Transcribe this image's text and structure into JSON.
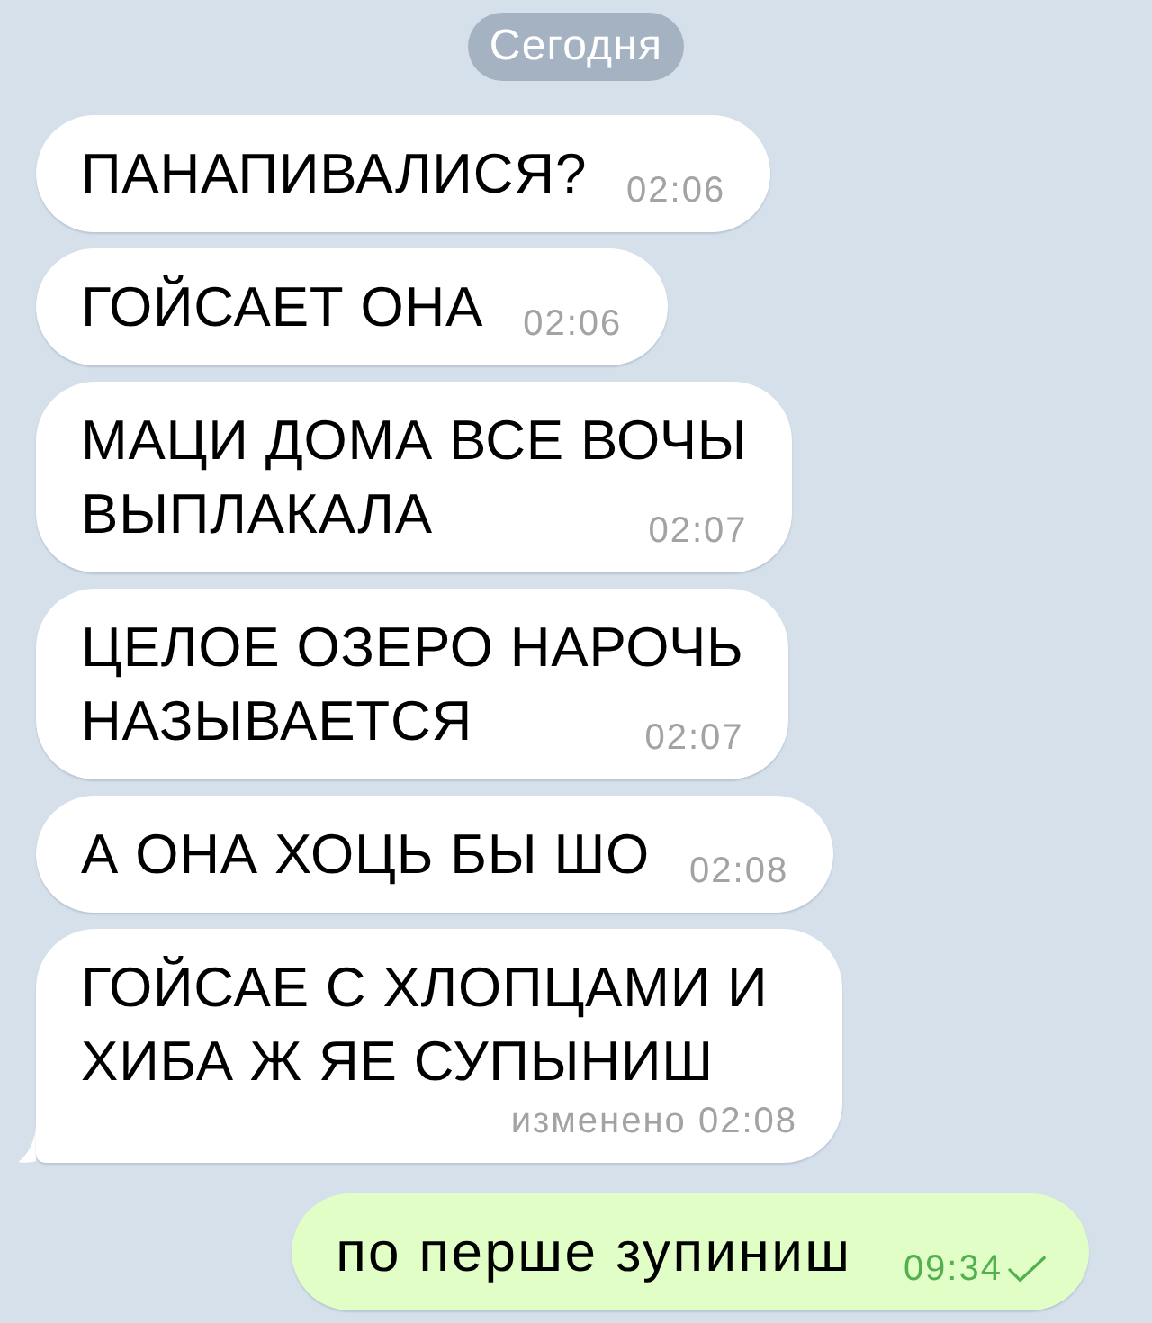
{
  "chat": {
    "date_label": "Сегодня",
    "messages": [
      {
        "kind": "incoming",
        "lines": [
          "ПАНАПИВАЛИСЯ?"
        ],
        "time": "02:06",
        "tail": false
      },
      {
        "kind": "incoming",
        "lines": [
          "ГОЙСАЕТ ОНА"
        ],
        "time": "02:06",
        "tail": false
      },
      {
        "kind": "incoming",
        "lines": [
          "МАЦИ ДОМА ВСЕ ВОЧЫ",
          "ВЫПЛАКАЛА"
        ],
        "time": "02:07",
        "tail": false
      },
      {
        "kind": "incoming",
        "lines": [
          "ЦЕЛОЕ ОЗЕРО НАРОЧЬ",
          "НАЗЫВАЕТСЯ"
        ],
        "time": "02:07",
        "tail": false
      },
      {
        "kind": "incoming",
        "lines": [
          "А ОНА ХОЦЬ БЫ ШО"
        ],
        "time": "02:08",
        "tail": false
      },
      {
        "kind": "incoming",
        "lines": [
          "ГОЙСАЕ С ХЛОПЦАМИ И",
          "ХИБА Ж ЯЕ СУПЫНИШ"
        ],
        "edited_label": "изменено",
        "time": "02:08",
        "tail": true
      },
      {
        "kind": "outgoing",
        "lines": [
          "по перше зупиниш"
        ],
        "time": "09:34",
        "read": false
      }
    ]
  }
}
